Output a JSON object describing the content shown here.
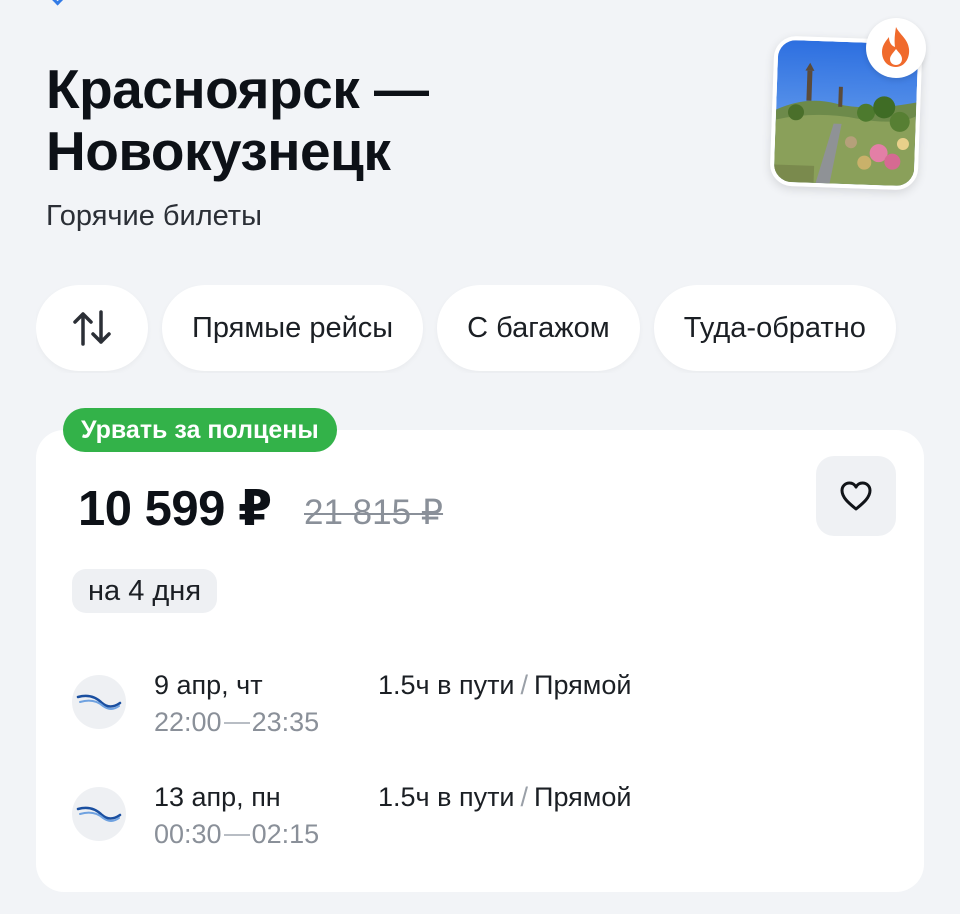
{
  "route": {
    "title": "Красноярск — Новокузнецк",
    "subtitle": "Горячие билеты"
  },
  "hero": {
    "image": "landscape-photo",
    "badge_icon": "fire-icon",
    "badge_color": "#f06a2c"
  },
  "filters": {
    "sort_icon": "sort-arrows-icon",
    "chips": [
      "Прямые рейсы",
      "С багажом",
      "Туда-обратно"
    ]
  },
  "offer": {
    "badge": "Урвать за полцены",
    "badge_color": "#33b249",
    "price": "10 599 ₽",
    "old_price": "21 815 ₽",
    "duration_tag": "на 4 дня",
    "favorite_icon": "heart-icon",
    "legs": [
      {
        "airline_icon": "airline-logo-icon",
        "date": "9 апр, чт",
        "depart": "22:00",
        "arrive": "23:35",
        "travel_time": "1.5ч в пути",
        "separator": "/",
        "stops": "Прямой"
      },
      {
        "airline_icon": "airline-logo-icon",
        "date": "13 апр, пн",
        "depart": "00:30",
        "arrive": "02:15",
        "travel_time": "1.5ч в пути",
        "separator": "/",
        "stops": "Прямой"
      }
    ]
  },
  "colors": {
    "background": "#f2f4f7",
    "card": "#ffffff",
    "accent_blue": "#1f6fe5"
  }
}
